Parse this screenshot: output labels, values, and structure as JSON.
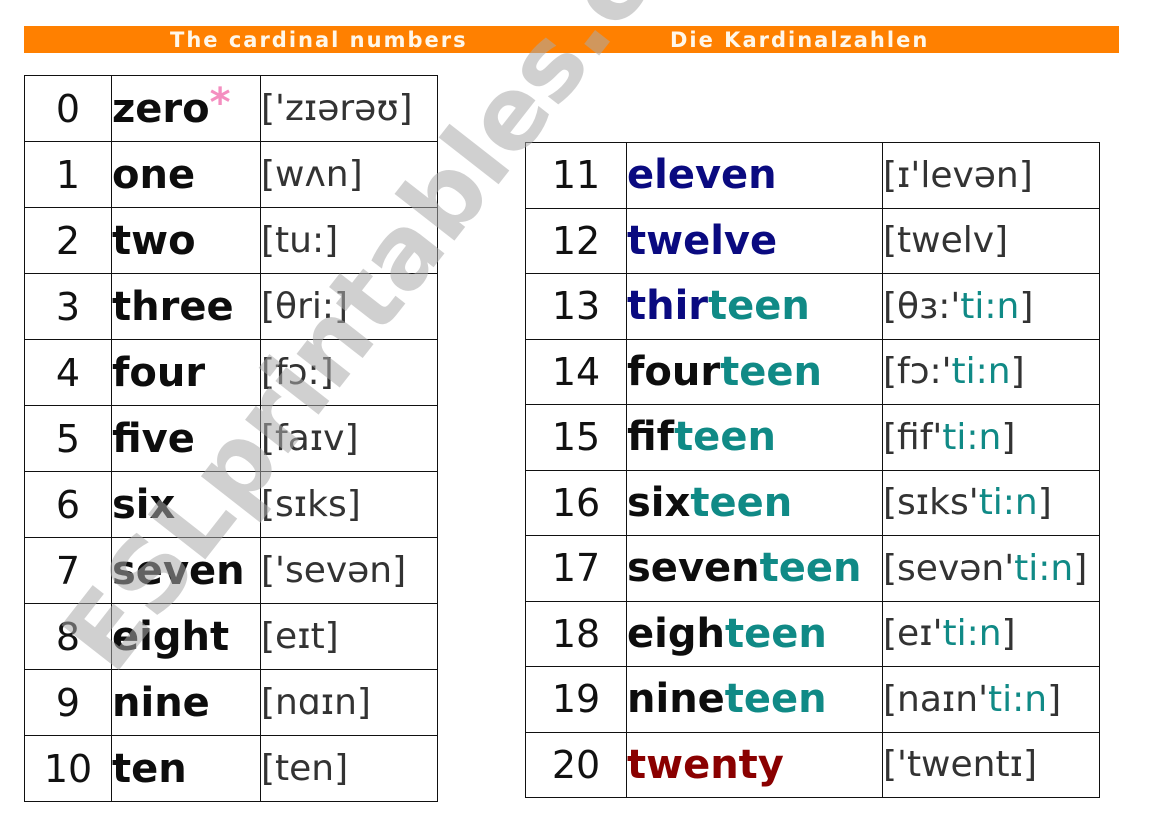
{
  "header": {
    "title_en": "The cardinal numbers",
    "title_de": "Die Kardinalzahlen",
    "bar_color": "#ff8000"
  },
  "colors": {
    "base_word": "#0d0d0d",
    "eleven_twelve_thir": "#0a0a80",
    "teen_suffix": "#108a86",
    "twenty": "#8a0000",
    "asterisk": "#f48ec0"
  },
  "left_table": [
    {
      "num": "0",
      "word": "zero",
      "asterisk": "*",
      "ipa": "['zɪərəʊ]"
    },
    {
      "num": "1",
      "word": "one",
      "ipa": "[wʌn]"
    },
    {
      "num": "2",
      "word": "two",
      "ipa": "[tu:]"
    },
    {
      "num": "3",
      "word": "three",
      "ipa": "[θri:]"
    },
    {
      "num": "4",
      "word": "four",
      "ipa": "[fɔ:]"
    },
    {
      "num": "5",
      "word": "five",
      "ipa": "[faɪv]"
    },
    {
      "num": "6",
      "word": "six",
      "ipa": "[sɪks]"
    },
    {
      "num": "7",
      "word": "seven",
      "ipa": "['sevən]"
    },
    {
      "num": "8",
      "word": "eight",
      "ipa": "[eɪt]"
    },
    {
      "num": "9",
      "word": "nine",
      "ipa": "[nɑɪn]"
    },
    {
      "num": "10",
      "word": "ten",
      "ipa": "[ten]"
    }
  ],
  "right_table": [
    {
      "num": "11",
      "word_base": "eleven",
      "word_suffix": "",
      "ipa_base": "[ɪ'levən]",
      "ipa_suffix": "",
      "ipa_end": ""
    },
    {
      "num": "12",
      "word_base": "twelve",
      "word_suffix": "",
      "ipa_base": "[twelv]",
      "ipa_suffix": "",
      "ipa_end": ""
    },
    {
      "num": "13",
      "word_base": "thir",
      "word_suffix": "teen",
      "ipa_base": "[θɜ:'",
      "ipa_suffix": "ti:n",
      "ipa_end": "]"
    },
    {
      "num": "14",
      "word_base": "four",
      "word_suffix": "teen",
      "ipa_base": "[fɔ:'",
      "ipa_suffix": "ti:n",
      "ipa_end": "]"
    },
    {
      "num": "15",
      "word_base": "fif",
      "word_suffix": "teen",
      "ipa_base": "[fif'",
      "ipa_suffix": "ti:n",
      "ipa_end": "]"
    },
    {
      "num": "16",
      "word_base": "six",
      "word_suffix": "teen",
      "ipa_base": "[sɪks'",
      "ipa_suffix": "ti:n",
      "ipa_end": "]"
    },
    {
      "num": "17",
      "word_base": "seven",
      "word_suffix": "teen",
      "ipa_base": "[sevən'",
      "ipa_suffix": "ti:n",
      "ipa_end": "]"
    },
    {
      "num": "18",
      "word_base": "eigh",
      "word_suffix": "teen",
      "ipa_base": "[eɪ'",
      "ipa_suffix": "ti:n",
      "ipa_end": "]"
    },
    {
      "num": "19",
      "word_base": "nine",
      "word_suffix": "teen",
      "ipa_base": "[naɪn'",
      "ipa_suffix": "ti:n",
      "ipa_end": "]"
    },
    {
      "num": "20",
      "word_base": "twenty",
      "word_suffix": "",
      "ipa_base": "['twentɪ]",
      "ipa_suffix": "",
      "ipa_end": ""
    }
  ],
  "watermark": "ESLprintables.com"
}
